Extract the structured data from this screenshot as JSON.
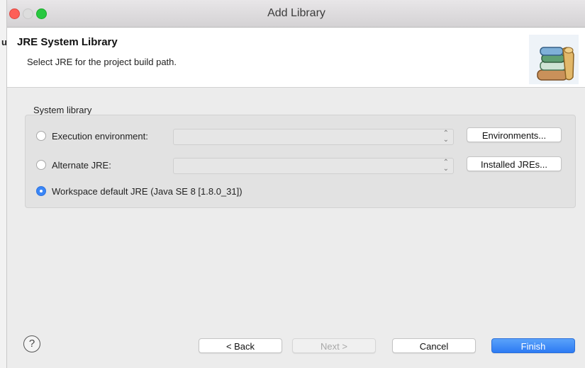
{
  "window": {
    "title": "Add Library"
  },
  "backdrop": {
    "letter": "u"
  },
  "header": {
    "title": "JRE System Library",
    "description": "Select JRE for the project build path.",
    "icon": "library-books-icon"
  },
  "system_library": {
    "label": "System library",
    "options": [
      {
        "label": "Execution environment:",
        "selected": false,
        "combo_value": "",
        "button": "Environments..."
      },
      {
        "label": "Alternate JRE:",
        "selected": false,
        "combo_value": "",
        "button": "Installed JREs..."
      },
      {
        "label": "Workspace default JRE (Java SE 8 [1.8.0_31])",
        "selected": true
      }
    ]
  },
  "footer": {
    "help": "?",
    "back": "< Back",
    "next": "Next >",
    "cancel": "Cancel",
    "finish": "Finish"
  },
  "colors": {
    "accent": "#3a86f7",
    "close": "#fd5f57",
    "maximize": "#28c840"
  }
}
